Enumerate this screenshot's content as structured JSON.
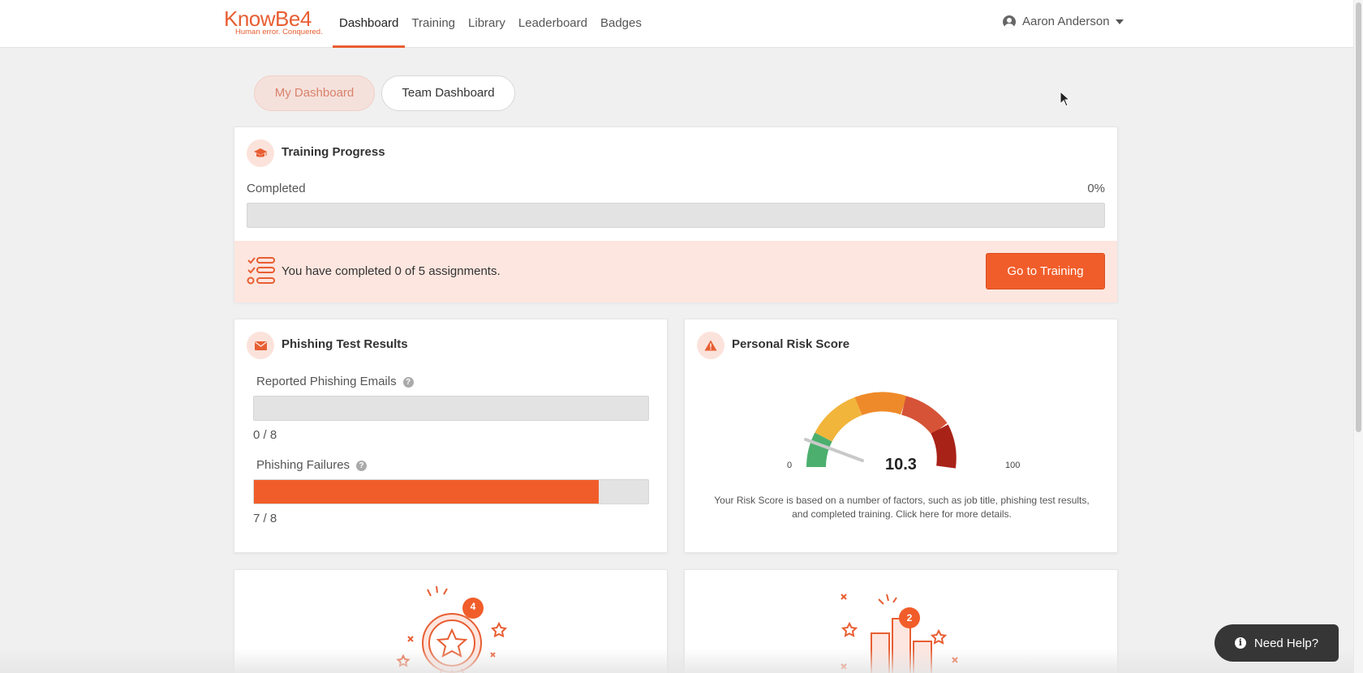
{
  "brand": {
    "name": "KnowBe4",
    "tagline": "Human error. Conquered."
  },
  "nav": {
    "items": [
      {
        "label": "Dashboard"
      },
      {
        "label": "Training"
      },
      {
        "label": "Library"
      },
      {
        "label": "Leaderboard"
      },
      {
        "label": "Badges"
      }
    ],
    "active": "Dashboard"
  },
  "user": {
    "name": "Aaron Anderson"
  },
  "toggle": {
    "my_dashboard": "My Dashboard",
    "team_dashboard": "Team Dashboard"
  },
  "training_progress": {
    "title": "Training Progress",
    "completed_label": "Completed",
    "percent_text": "0%",
    "percent": 0,
    "assignments_text": "You have completed 0 of 5 assignments.",
    "button": "Go to Training"
  },
  "phishing": {
    "title": "Phishing Test Results",
    "reported_label": "Reported Phishing Emails",
    "reported_count": "0 / 8",
    "reported_fraction": 0,
    "failures_label": "Phishing Failures",
    "failures_count": "7 / 8",
    "failures_fraction": 0.875
  },
  "risk": {
    "title": "Personal Risk Score",
    "score": "10.3",
    "score_value": 10.3,
    "min": "0",
    "max": "100",
    "description": "Your Risk Score is based on a number of factors, such as job title, phishing test results, and completed training. Click here for more details."
  },
  "badges_card": {
    "count": "4"
  },
  "leaderboard_card": {
    "count": "2"
  },
  "help": {
    "label": "Need Help?"
  },
  "colors": {
    "accent": "#f15d2a",
    "accent_light": "#fde6df"
  },
  "icons": {
    "training": "graduation-cap-icon",
    "phishing": "envelope-icon",
    "risk": "warning-triangle-icon",
    "assignments": "checklist-icon",
    "help": "question-icon",
    "info": "info-icon",
    "user": "user-circle-icon"
  }
}
